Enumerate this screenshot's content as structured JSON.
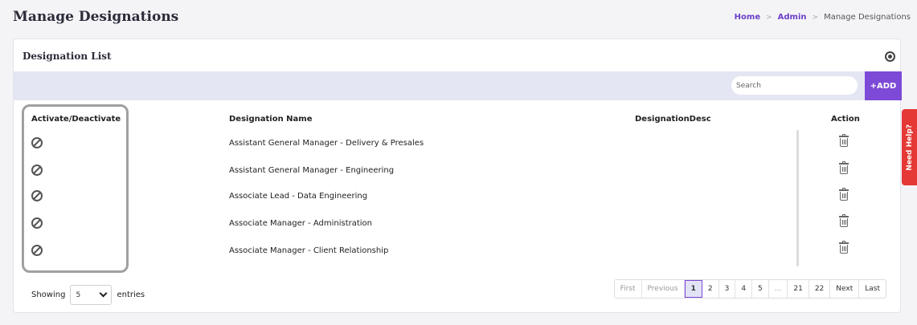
{
  "header": {
    "title": "Manage Designations",
    "breadcrumb": [
      "Home",
      "Admin",
      "Manage Designations"
    ]
  },
  "card": {
    "title": "Designation List",
    "search_placeholder": "Search",
    "add_label": "+ADD"
  },
  "table": {
    "columns": [
      "Activate/Deactivate",
      "Designation Name",
      "DesignationDesc",
      "Action"
    ],
    "rows": [
      {
        "name": "Assistant General Manager - Delivery & Presales",
        "desc": ""
      },
      {
        "name": "Assistant General Manager - Engineering",
        "desc": ""
      },
      {
        "name": "Associate Lead - Data Engineering",
        "desc": ""
      },
      {
        "name": "Associate Manager - Administration",
        "desc": ""
      },
      {
        "name": "Associate Manager - Client Relationship",
        "desc": ""
      }
    ]
  },
  "footer": {
    "showing_label": "Showing",
    "entries_value": "5",
    "entries_label": "entries",
    "pagination": [
      "First",
      "Previous",
      "1",
      "2",
      "3",
      "4",
      "5",
      "...",
      "21",
      "22",
      "Next",
      "Last"
    ]
  },
  "help_tab": "Need Help?",
  "icons": {
    "row_toggle": "ban-icon",
    "row_action": "trash-icon",
    "card_settings": "settings-icon"
  },
  "colors": {
    "accent": "#7c4ad6",
    "toolbar_bg": "#e5e6f3",
    "help_tab": "#e53935"
  }
}
